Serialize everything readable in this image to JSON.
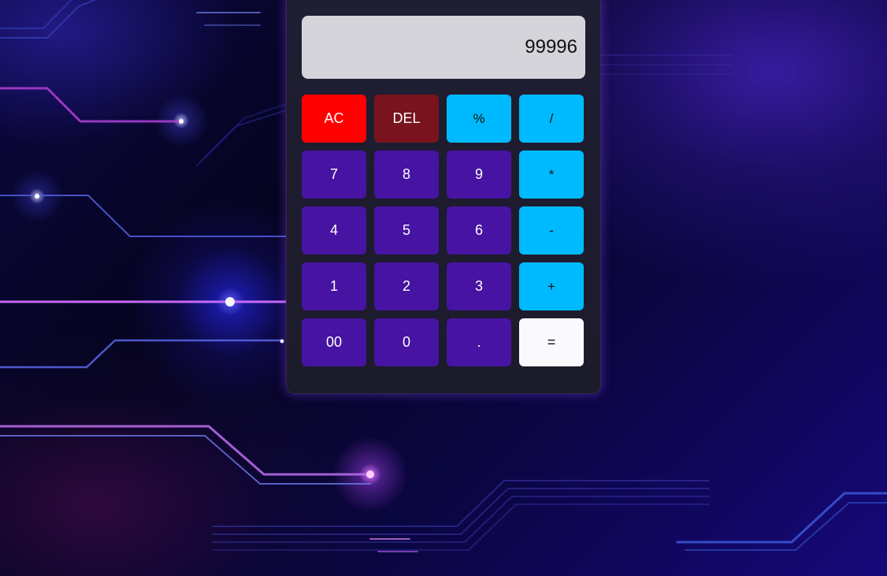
{
  "display": {
    "value": "99996"
  },
  "keys": [
    {
      "label": "AC",
      "kind": "clear",
      "name": "all-clear-button",
      "color": "#ff0000"
    },
    {
      "label": "DEL",
      "kind": "delete",
      "name": "delete-button",
      "color": "#79131e"
    },
    {
      "label": "%",
      "kind": "operator",
      "name": "percent-button",
      "color": "#00baff"
    },
    {
      "label": "/",
      "kind": "operator",
      "name": "divide-button",
      "color": "#00baff"
    },
    {
      "label": "7",
      "kind": "digit",
      "name": "digit-7-button",
      "color": "#4613a2"
    },
    {
      "label": "8",
      "kind": "digit",
      "name": "digit-8-button",
      "color": "#4613a2"
    },
    {
      "label": "9",
      "kind": "digit",
      "name": "digit-9-button",
      "color": "#4613a2"
    },
    {
      "label": "*",
      "kind": "operator",
      "name": "multiply-button",
      "color": "#00baff"
    },
    {
      "label": "4",
      "kind": "digit",
      "name": "digit-4-button",
      "color": "#4613a2"
    },
    {
      "label": "5",
      "kind": "digit",
      "name": "digit-5-button",
      "color": "#4613a2"
    },
    {
      "label": "6",
      "kind": "digit",
      "name": "digit-6-button",
      "color": "#4613a2"
    },
    {
      "label": "-",
      "kind": "operator",
      "name": "subtract-button",
      "color": "#00baff"
    },
    {
      "label": "1",
      "kind": "digit",
      "name": "digit-1-button",
      "color": "#4613a2"
    },
    {
      "label": "2",
      "kind": "digit",
      "name": "digit-2-button",
      "color": "#4613a2"
    },
    {
      "label": "3",
      "kind": "digit",
      "name": "digit-3-button",
      "color": "#4613a2"
    },
    {
      "label": "+",
      "kind": "operator",
      "name": "add-button",
      "color": "#00baff"
    },
    {
      "label": "00",
      "kind": "digit",
      "name": "double-zero-button",
      "color": "#4613a2"
    },
    {
      "label": "0",
      "kind": "digit",
      "name": "digit-0-button",
      "color": "#4613a2"
    },
    {
      "label": ".",
      "kind": "digit",
      "name": "decimal-point-button",
      "color": "#4613a2"
    },
    {
      "label": "=",
      "kind": "equals",
      "name": "equals-button",
      "color": "#fafafe"
    }
  ]
}
